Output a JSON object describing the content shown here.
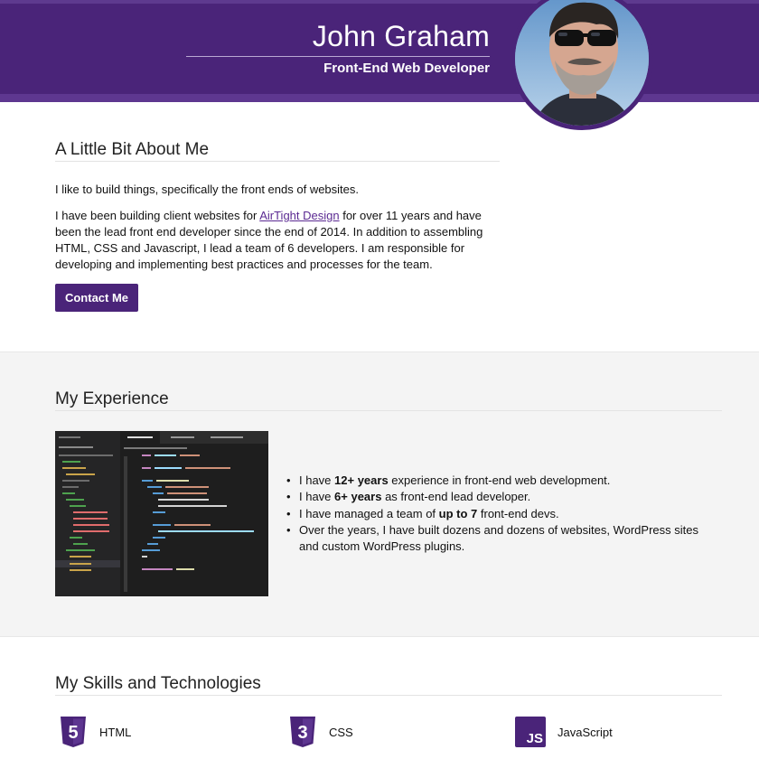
{
  "header": {
    "name": "John Graham",
    "subtitle": "Front-End Web Developer"
  },
  "about": {
    "title": "A Little Bit About Me",
    "p1": "I like to build things, specifically the front ends of websites.",
    "p2_before_link": "I have been building client websites for ",
    "p2_link": "AirTight Design",
    "p2_after_link": " for over 11 years and have been the lead front end developer since the end of 2014. In addition to assembling HTML, CSS and Javascript, I lead a team of 6 developers. I am responsible for developing and implementing best practices and processes for the team.",
    "contact_label": "Contact Me"
  },
  "experience": {
    "title": "My Experience",
    "items": [
      {
        "before": "I have ",
        "bold": "12+ years",
        "after": " experience in front-end web development."
      },
      {
        "before": "I have ",
        "bold": "6+ years",
        "after": " as front-end lead developer."
      },
      {
        "before": "I have managed a team of ",
        "bold": "up to 7",
        "after": " front-end devs."
      },
      {
        "before": "Over the years, I have built dozens and dozens of websites, WordPress sites and custom WordPress plugins.",
        "bold": "",
        "after": ""
      }
    ]
  },
  "skills": {
    "title": "My Skills and Technologies",
    "items": [
      {
        "label": "HTML",
        "icon": "html5-icon",
        "badge": "5"
      },
      {
        "label": "CSS",
        "icon": "css3-icon",
        "badge": "3"
      },
      {
        "label": "JavaScript",
        "icon": "javascript-icon",
        "badge": "JS"
      }
    ]
  },
  "colors": {
    "brand_purple": "#4a2479",
    "section_bg": "#f4f4f4",
    "link": "#5b2a92"
  }
}
